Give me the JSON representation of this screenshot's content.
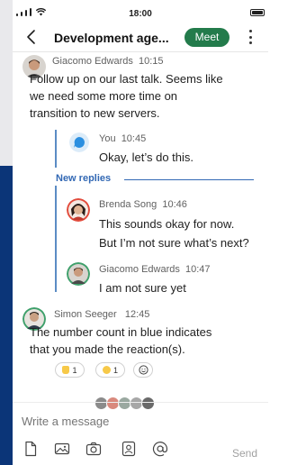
{
  "status_bar": {
    "time": "18:00"
  },
  "header": {
    "title": "Development age...",
    "meet_label": "Meet"
  },
  "messages": [
    {
      "author": "Giacomo Edwards",
      "time": "10:15",
      "text_lines": [
        "Follow up on our last talk. Seems like",
        "we need some more time on",
        "transition to new servers."
      ],
      "replies": [
        {
          "author": "You",
          "time": "10:45",
          "text": "Okay, let’s do this."
        }
      ],
      "new_replies_label": "New replies",
      "new_replies": [
        {
          "author": "Brenda Song",
          "time": "10:46",
          "text_lines": [
            "This sounds okay for now.",
            "But I’m not sure what’s next?"
          ]
        },
        {
          "author": "Giacomo Edwards",
          "time": "10:47",
          "text_lines": [
            "I am not sure yet"
          ]
        }
      ]
    },
    {
      "author": "Simon Seeger",
      "time": "12:45",
      "text_lines": [
        "The number count in blue indicates",
        "that you made the reaction(s)."
      ],
      "reactions": [
        {
          "emoji": "thumbs-up",
          "count": "1"
        },
        {
          "emoji": "smile",
          "count": "1"
        }
      ]
    }
  ],
  "composer": {
    "placeholder": "Write a message",
    "send_label": "Send"
  },
  "colors": {
    "accent": "#3268b4",
    "meet": "#237b4b",
    "background_band_top": "#e9e9ec",
    "background_band_bottom": "#0b3578"
  }
}
